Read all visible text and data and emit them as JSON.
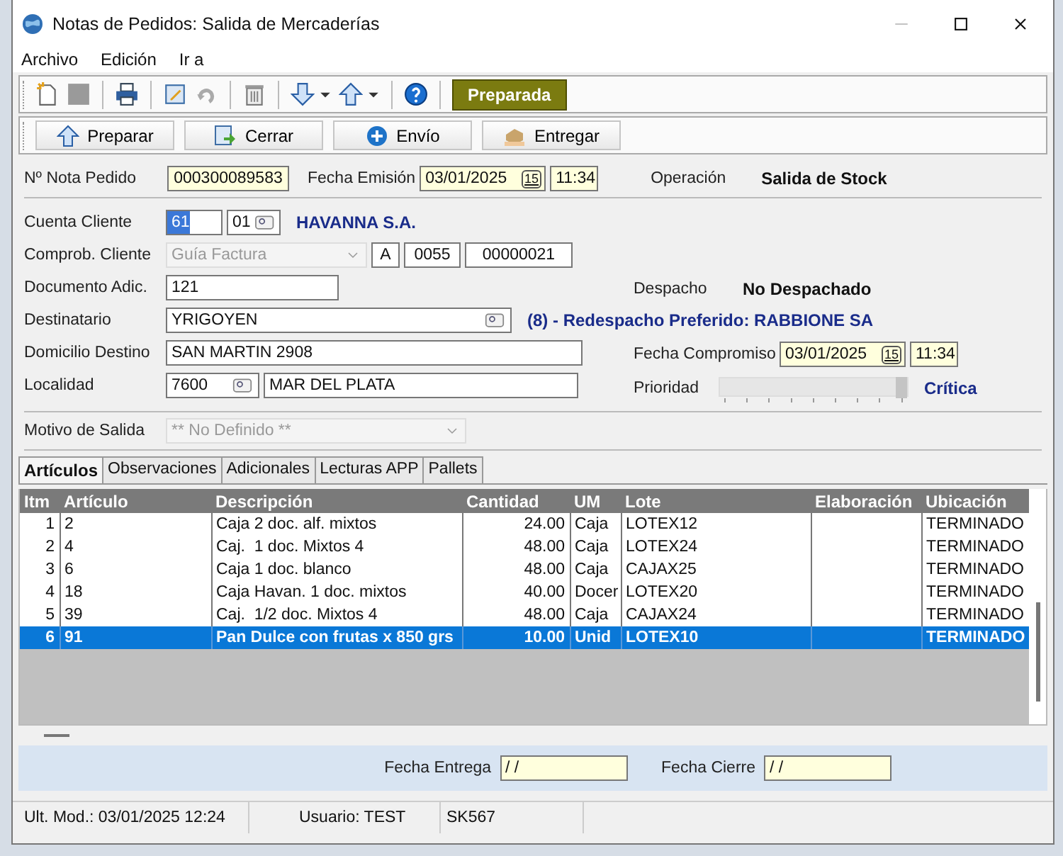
{
  "window": {
    "title": "Notas de Pedidos: Salida de Mercaderías"
  },
  "menu": [
    "Archivo",
    "Edición",
    "Ir a"
  ],
  "toolbar": {
    "status": "Preparada"
  },
  "actions": [
    "Preparar",
    "Cerrar",
    "Envío",
    "Entregar"
  ],
  "header": {
    "nota_label": "Nº Nota Pedido",
    "nota": "000300089583",
    "fecha_label": "Fecha Emisión",
    "fecha": "03/01/2025",
    "cal": "15",
    "hora": "11:34",
    "operacion_label": "Operación",
    "operacion": "Salida de Stock"
  },
  "cliente": {
    "label": "Cuenta Cliente",
    "cuenta": "61",
    "sucursal": "01",
    "nombre": "HAVANNA S.A."
  },
  "comprob": {
    "label": "Comprob. Cliente",
    "tipo": "Guía Factura",
    "letra": "A",
    "punto": "0055",
    "numero": "00000021"
  },
  "documento": {
    "label": "Documento Adic.",
    "value": "121"
  },
  "despacho": {
    "label": "Despacho",
    "value": "No Despachado"
  },
  "destinatario": {
    "label": "Destinatario",
    "value": "YRIGOYEN",
    "redespacho": "(8) - Redespacho Preferido: RABBIONE SA"
  },
  "domicilio": {
    "label": "Domicilio Destino",
    "value": "SAN MARTIN 2908"
  },
  "compromiso": {
    "label": "Fecha Compromiso",
    "fecha": "03/01/2025",
    "cal": "15",
    "hora": "11:34"
  },
  "localidad": {
    "label": "Localidad",
    "cp": "7600",
    "nombre": "MAR DEL PLATA"
  },
  "prioridad": {
    "label": "Prioridad",
    "level": 1,
    "value": "Crítica"
  },
  "motivo": {
    "label": "Motivo de Salida",
    "placeholder": "** No Definido **"
  },
  "tabs": [
    {
      "label": "Artículos",
      "selected": true
    },
    {
      "label": "Observaciones",
      "selected": false
    },
    {
      "label": "Adicionales",
      "selected": false
    },
    {
      "label": "Lecturas APP",
      "selected": false
    },
    {
      "label": "Pallets",
      "selected": false
    }
  ],
  "table": {
    "columns": [
      "Itm",
      "Artículo",
      "Descripción",
      "Cantidad",
      "UM",
      "Lote",
      "Elaboración",
      "Ubicación"
    ],
    "rows": [
      {
        "cells": [
          "1",
          "2",
          "Caja 2 doc. alf. mixtos",
          "24.00",
          "Caja",
          "LOTEX12",
          "",
          "TERMINADO"
        ],
        "selected": false
      },
      {
        "cells": [
          "2",
          "4",
          "Caj.  1 doc. Mixtos 4",
          "48.00",
          "Caja",
          "LOTEX24",
          "",
          "TERMINADO"
        ],
        "selected": false
      },
      {
        "cells": [
          "3",
          "6",
          "Caja 1 doc. blanco",
          "48.00",
          "Caja",
          "CAJAX25",
          "",
          "TERMINADO"
        ],
        "selected": false
      },
      {
        "cells": [
          "4",
          "18",
          "Caja Havan. 1 doc. mixtos",
          "40.00",
          "Docer",
          "LOTEX20",
          "",
          "TERMINADO"
        ],
        "selected": false
      },
      {
        "cells": [
          "5",
          "39",
          "Caj.  1/2 doc. Mixtos 4",
          "48.00",
          "Caja",
          "CAJAX24",
          "",
          "TERMINADO"
        ],
        "selected": false
      },
      {
        "cells": [
          "6",
          "91",
          "Pan Dulce con frutas x 850 grs",
          "10.00",
          "Unid",
          "LOTEX10",
          "",
          "TERMINADO"
        ],
        "selected": true
      }
    ]
  },
  "footer": {
    "entrega_label": "Fecha Entrega",
    "entrega": "/ /",
    "cierre_label": "Fecha Cierre",
    "cierre": "/ /"
  },
  "status_bar": [
    "Ult. Mod.: 03/01/2025 12:24",
    "Usuario: TEST",
    "SK567"
  ]
}
